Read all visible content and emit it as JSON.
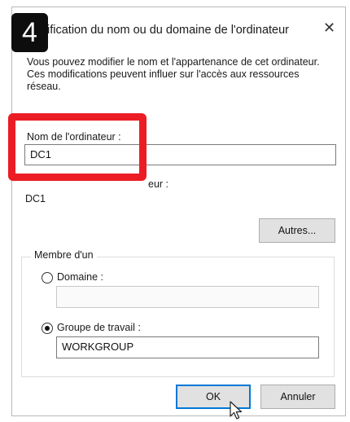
{
  "step_badge": "4",
  "dialog": {
    "title": "ification du nom ou du domaine de l'ordinateur",
    "close_glyph": "✕",
    "description": "Vous pouvez modifier le nom et l'appartenance de cet ordinateur. Ces modifications peuvent influer sur l'accès aux ressources réseau.",
    "computer_name_label": "Nom de l'ordinateur :",
    "computer_name_value": "DC1",
    "full_name_label": "eur :",
    "full_name_value": "DC1",
    "more_button": "Autres...",
    "member_of": {
      "legend": "Membre d'un",
      "domain_label": "Domaine :",
      "domain_value": "",
      "domain_selected": false,
      "workgroup_label": "Groupe de travail :",
      "workgroup_value": "WORKGROUP",
      "workgroup_selected": true
    },
    "ok_button": "OK",
    "cancel_button": "Annuler"
  },
  "colors": {
    "highlight": "#ec1c24",
    "badge": "#0d0d0d",
    "default_button_border": "#0078d7"
  }
}
